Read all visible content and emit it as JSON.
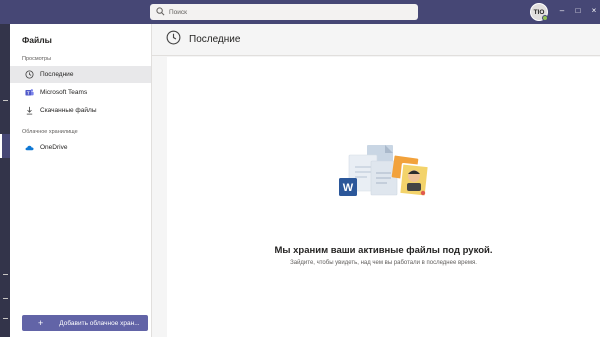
{
  "topbar": {
    "search_placeholder": "Поиск",
    "avatar_initials": "TIO",
    "window_controls": [
      "–",
      "□",
      "×"
    ]
  },
  "sidebar": {
    "title": "Файлы",
    "section_views": "Просмотры",
    "views": [
      {
        "label": "Последние",
        "icon": "clock-icon",
        "active": true
      },
      {
        "label": "Microsoft Teams",
        "icon": "teams-icon",
        "active": false
      },
      {
        "label": "Скачанные файлы",
        "icon": "download-icon",
        "active": false
      }
    ],
    "section_cloud": "Облачное хранилище",
    "cloud": [
      {
        "label": "OneDrive",
        "icon": "onedrive-icon"
      }
    ],
    "add_cloud_label": "Добавить облачное хран..."
  },
  "main": {
    "title": "Последние",
    "empty_title": "Мы храним ваши активные файлы под рукой.",
    "empty_subtitle": "Зайдите, чтобы увидеть, над чем вы работали в последнее время."
  },
  "colors": {
    "accent": "#6264a7",
    "topbar": "#464775",
    "rail": "#33344a"
  }
}
